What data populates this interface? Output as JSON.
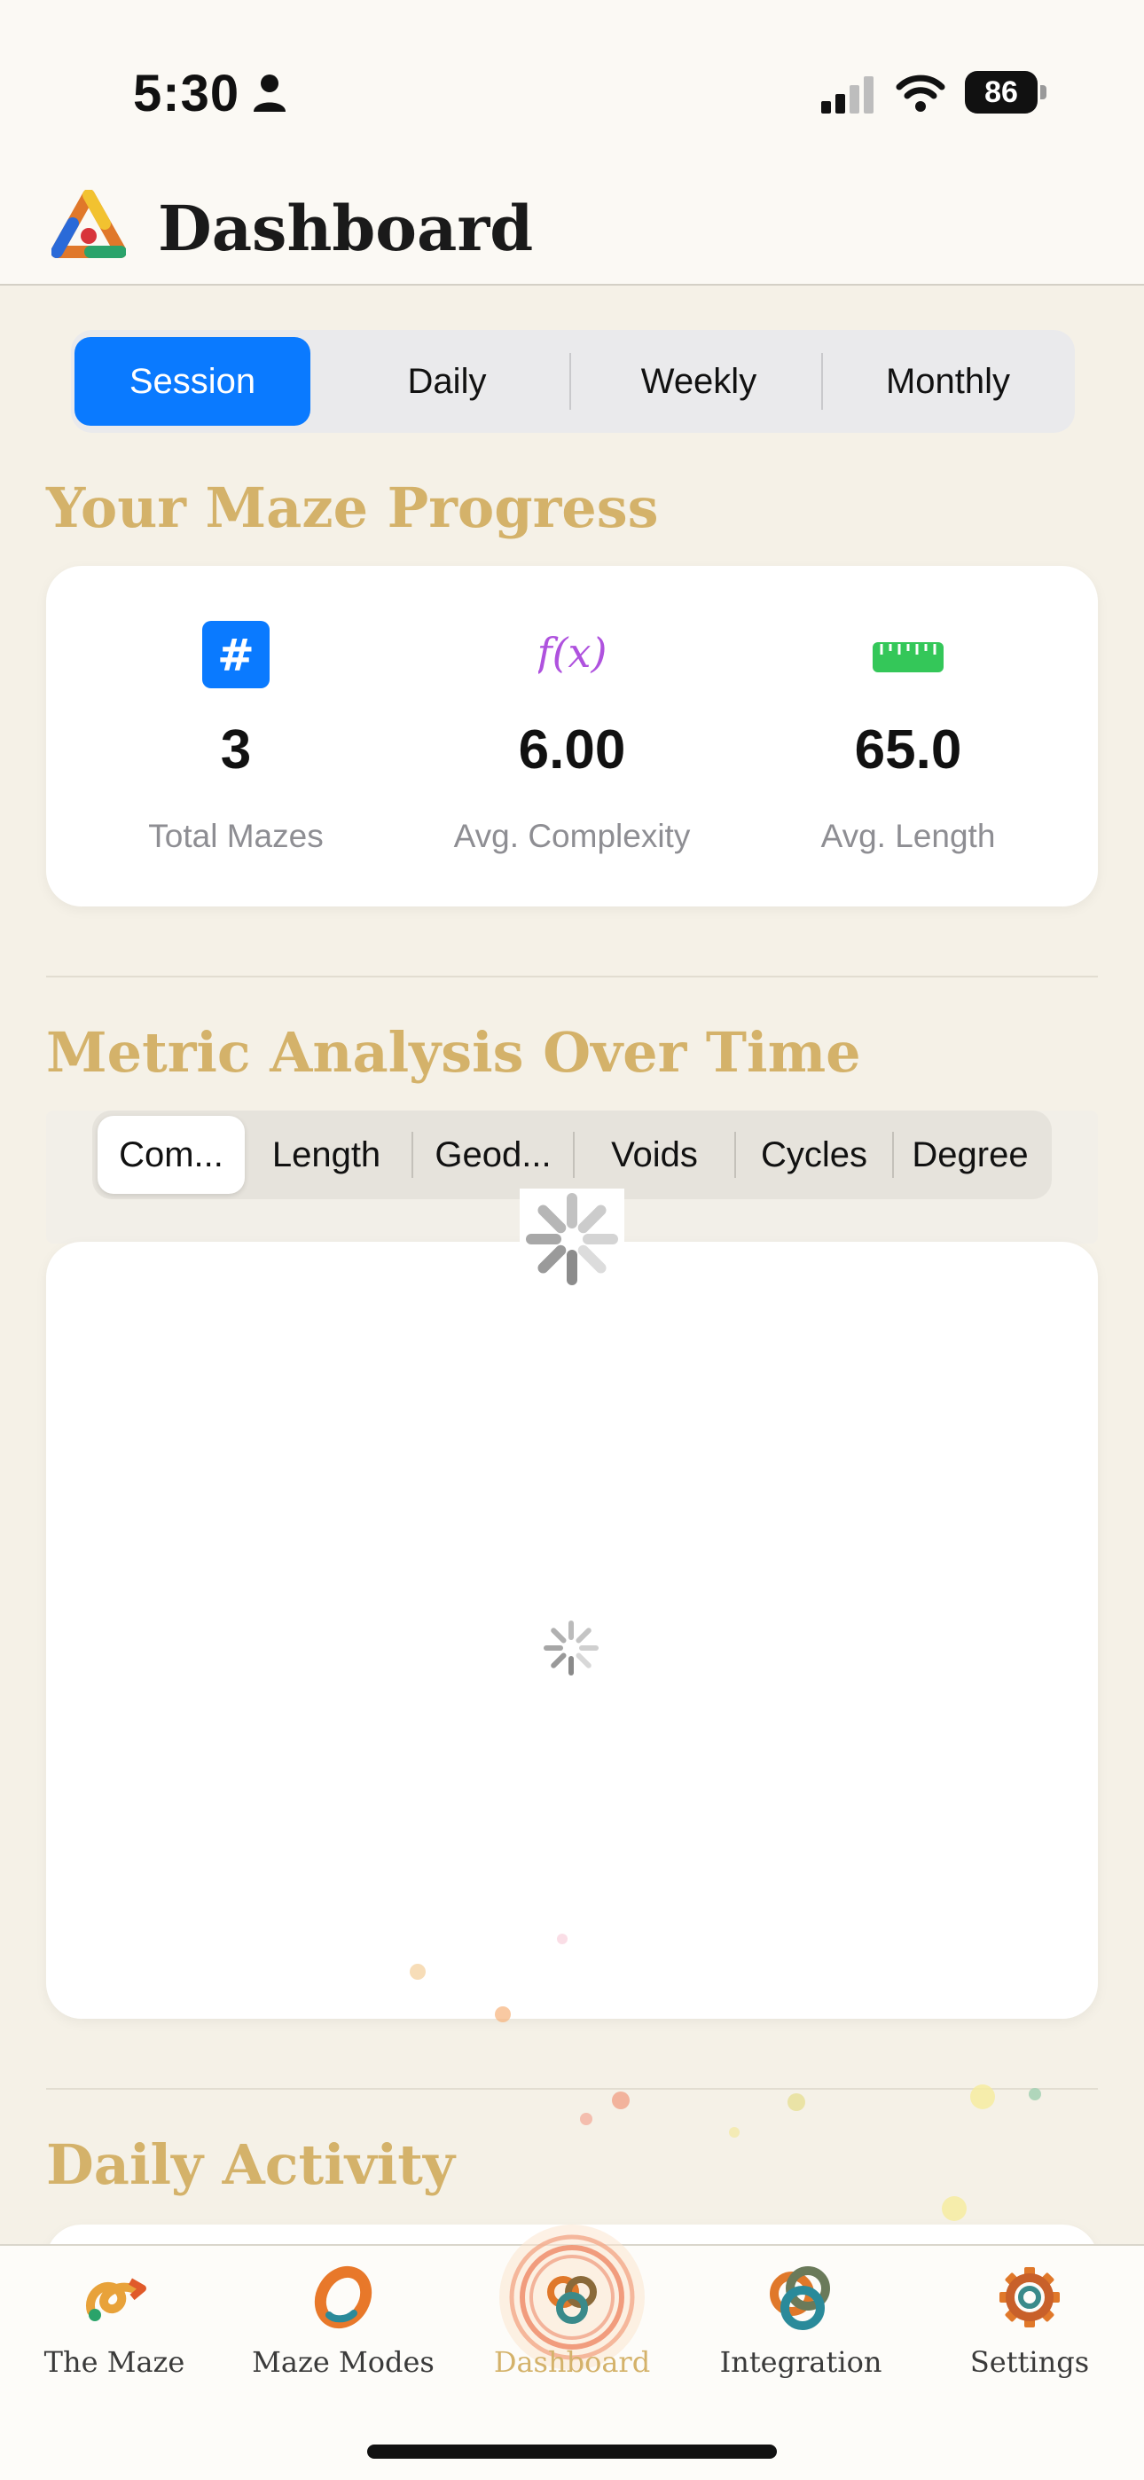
{
  "status_bar": {
    "time": "5:30",
    "battery": "86"
  },
  "header": {
    "title": "Dashboard"
  },
  "period_tabs": [
    {
      "label": "Session",
      "active": true
    },
    {
      "label": "Daily",
      "active": false
    },
    {
      "label": "Weekly",
      "active": false
    },
    {
      "label": "Monthly",
      "active": false
    }
  ],
  "progress": {
    "title": "Your Maze Progress",
    "stats": [
      {
        "icon": "hash-icon",
        "value": "3",
        "label": "Total Mazes",
        "color": "#0a7aff"
      },
      {
        "icon": "function-icon",
        "value": "6.00",
        "label": "Avg. Complexity",
        "color": "#af52de"
      },
      {
        "icon": "ruler-icon",
        "value": "65.0",
        "label": "Avg. Length",
        "color": "#34c759"
      }
    ]
  },
  "metric_analysis": {
    "title": "Metric Analysis Over Time",
    "tabs": [
      {
        "label": "Com...",
        "active": true
      },
      {
        "label": "Length",
        "active": false
      },
      {
        "label": "Geod...",
        "active": false
      },
      {
        "label": "Voids",
        "active": false
      },
      {
        "label": "Cycles",
        "active": false
      },
      {
        "label": "Degree",
        "active": false
      }
    ]
  },
  "daily_activity": {
    "title": "Daily Activity"
  },
  "tab_bar": [
    {
      "label": "The Maze",
      "icon": "maze-swirl-icon",
      "active": false
    },
    {
      "label": "Maze Modes",
      "icon": "maze-modes-icon",
      "active": false
    },
    {
      "label": "Dashboard",
      "icon": "dashboard-knot-icon",
      "active": true
    },
    {
      "label": "Integration",
      "icon": "integration-rings-icon",
      "active": false
    },
    {
      "label": "Settings",
      "icon": "settings-gear-icon",
      "active": false
    }
  ],
  "colors": {
    "accent": "#0a7aff",
    "section_title": "#d4b26a",
    "background": "#f5f1e7"
  }
}
